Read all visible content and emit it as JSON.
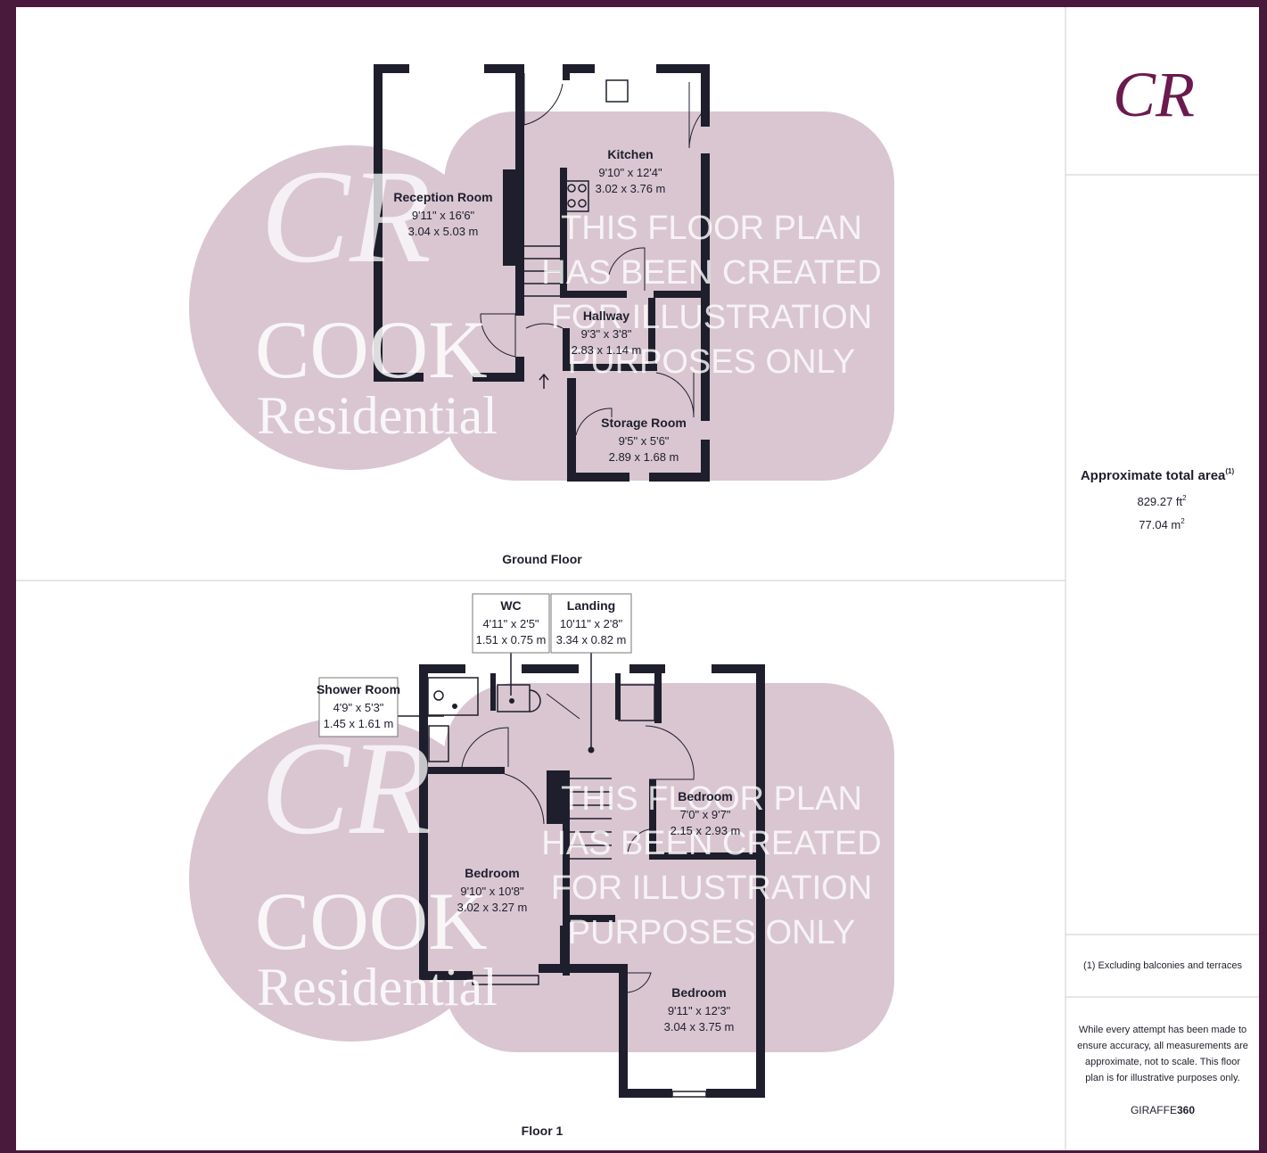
{
  "logo": {
    "monogram": "CR",
    "color": "#6b1a4e"
  },
  "watermark": {
    "monogram": "CR",
    "brand_top": "COOK",
    "brand_bottom": "Residential",
    "notice_lines": [
      "THIS FLOOR PLAN",
      "HAS BEEN CREATED",
      "FOR ILLUSTRATION",
      "PURPOSES ONLY"
    ],
    "color": "#d9c6d1"
  },
  "ground_floor": {
    "label": "Ground Floor",
    "rooms": [
      {
        "name": "Reception Room",
        "imperial": "9'11\" x 16'6\"",
        "metric": "3.04 x 5.03 m"
      },
      {
        "name": "Kitchen",
        "imperial": "9'10\" x 12'4\"",
        "metric": "3.02 x 3.76 m"
      },
      {
        "name": "Hallway",
        "imperial": "9'3\" x 3'8\"",
        "metric": "2.83 x 1.14 m"
      },
      {
        "name": "Storage Room",
        "imperial": "9'5\" x 5'6\"",
        "metric": "2.89 x 1.68 m"
      }
    ]
  },
  "floor_1": {
    "label": "Floor 1",
    "rooms": [
      {
        "name": "WC",
        "imperial": "4'11\" x 2'5\"",
        "metric": "1.51 x 0.75 m"
      },
      {
        "name": "Landing",
        "imperial": "10'11\" x 2'8\"",
        "metric": "3.34 x 0.82 m"
      },
      {
        "name": "Shower Room",
        "imperial": "4'9\" x 5'3\"",
        "metric": "1.45 x 1.61 m"
      },
      {
        "name": "Bedroom",
        "imperial": "7'0\" x 9'7\"",
        "metric": "2.15 x 2.93 m"
      },
      {
        "name": "Bedroom",
        "imperial": "9'10\" x 10'8\"",
        "metric": "3.02 x 3.27 m"
      },
      {
        "name": "Bedroom",
        "imperial": "9'11\" x 12'3\"",
        "metric": "3.04 x 3.75 m"
      }
    ]
  },
  "summary": {
    "title": "Approximate total area",
    "title_note": "(1)",
    "area_ft": "829.27 ft",
    "area_m": "77.04 m",
    "unit_power": "2",
    "footnote": "(1) Excluding balconies and terraces",
    "disclaimer_lines": [
      "While every attempt has been made to",
      "ensure accuracy, all measurements are",
      "approximate, not to scale. This floor",
      "plan is for illustrative purposes only."
    ],
    "brand_prefix": "GIRAFFE",
    "brand_suffix": "360"
  }
}
